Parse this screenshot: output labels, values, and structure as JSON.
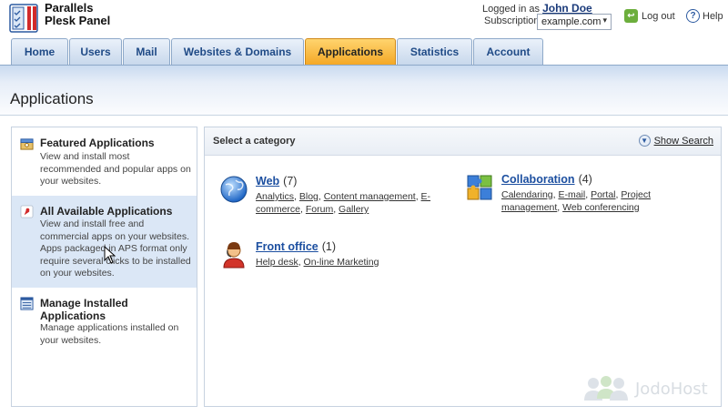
{
  "header": {
    "brand_line1": "Parallels",
    "brand_line2": "Plesk Panel",
    "logged_in_label": "Logged in as",
    "user_name": "John Doe",
    "subscription_label": "Subscription",
    "subscription_value": "example.com",
    "logout_label": "Log out",
    "help_label": "Help"
  },
  "tabs": [
    {
      "label": "Home",
      "active": false
    },
    {
      "label": "Users",
      "active": false
    },
    {
      "label": "Mail",
      "active": false
    },
    {
      "label": "Websites & Domains",
      "active": false
    },
    {
      "label": "Applications",
      "active": true
    },
    {
      "label": "Statistics",
      "active": false
    },
    {
      "label": "Account",
      "active": false
    }
  ],
  "page": {
    "title": "Applications"
  },
  "sidebar": {
    "items": [
      {
        "title": "Featured Applications",
        "description": "View and install most recommended and popular apps on your websites.",
        "icon": "featured-apps-icon",
        "selected": false
      },
      {
        "title": "All Available Applications",
        "description": "View and install free and commercial apps on your websites. Apps packaged in APS format only require several clicks to be installed on your websites.",
        "icon": "all-apps-icon",
        "selected": true
      },
      {
        "title": "Manage Installed Applications",
        "description": "Manage applications installed on your websites.",
        "icon": "installed-apps-icon",
        "selected": false
      }
    ]
  },
  "main": {
    "heading": "Select a category",
    "show_search": "Show Search",
    "categories": [
      {
        "name": "Web",
        "count": "(7)",
        "icon": "globe-icon",
        "links": [
          "Analytics",
          "Blog",
          "Content management",
          "E-commerce",
          "Forum",
          "Gallery"
        ]
      },
      {
        "name": "Collaboration",
        "count": "(4)",
        "icon": "puzzle-icon",
        "links": [
          "Calendaring",
          "E-mail",
          "Portal",
          "Project management",
          "Web conferencing"
        ]
      },
      {
        "name": "Front office",
        "count": "(1)",
        "icon": "support-agent-icon",
        "links": [
          "Help desk",
          "On-line Marketing"
        ]
      }
    ]
  },
  "watermark": "JodoHost",
  "colors": {
    "tab_active": "#f4a826",
    "tab_inactive": "#c8d8ec",
    "link": "#1c4fa0",
    "selected_item": "#dbe7f6"
  }
}
